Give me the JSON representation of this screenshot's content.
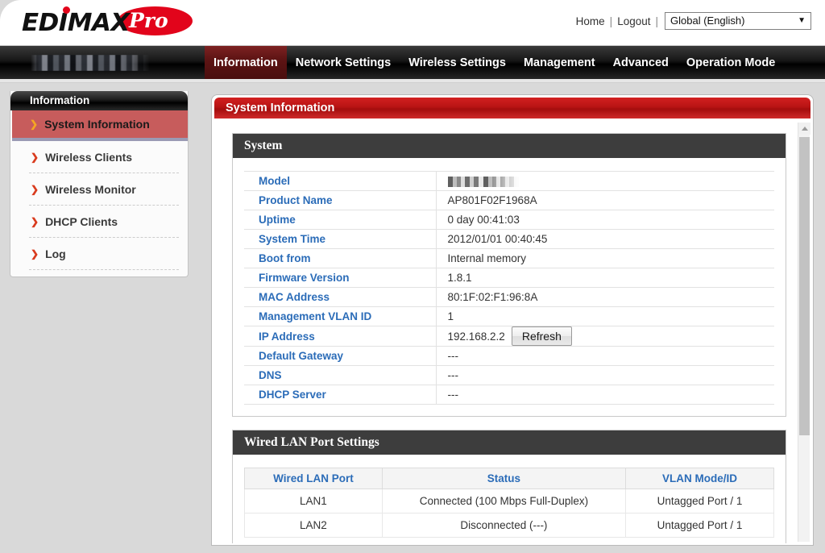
{
  "header": {
    "brand_primary": "EDIMAX",
    "brand_secondary": "Pro",
    "home_label": "Home",
    "logout_label": "Logout",
    "separator": "|",
    "language_value": "Global (English)",
    "dropdown_icon": "chevron-down-icon"
  },
  "nav": {
    "device_name": "",
    "items": [
      {
        "label": "Information",
        "active": true
      },
      {
        "label": "Network Settings",
        "active": false
      },
      {
        "label": "Wireless Settings",
        "active": false
      },
      {
        "label": "Management",
        "active": false
      },
      {
        "label": "Advanced",
        "active": false
      },
      {
        "label": "Operation Mode",
        "active": false
      }
    ]
  },
  "sidebar": {
    "title": "Information",
    "items": [
      {
        "label": "System Information",
        "active": true
      },
      {
        "label": "Wireless Clients",
        "active": false
      },
      {
        "label": "Wireless Monitor",
        "active": false
      },
      {
        "label": "DHCP Clients",
        "active": false
      },
      {
        "label": "Log",
        "active": false
      }
    ]
  },
  "content": {
    "title": "System Information",
    "system_section": {
      "heading": "System",
      "rows": [
        {
          "key": "Model",
          "value": "",
          "redacted": true
        },
        {
          "key": "Product Name",
          "value": "AP801F02F1968A"
        },
        {
          "key": "Uptime",
          "value": " 0 day 00:41:03"
        },
        {
          "key": "System Time",
          "value": "2012/01/01 00:40:45"
        },
        {
          "key": "Boot from",
          "value": "Internal memory"
        },
        {
          "key": "Firmware Version",
          "value": "1.8.1"
        },
        {
          "key": "MAC Address",
          "value": "80:1F:02:F1:96:8A"
        },
        {
          "key": "Management VLAN ID",
          "value": "1"
        },
        {
          "key": "IP Address",
          "value": "192.168.2.2",
          "button": "Refresh"
        },
        {
          "key": "Default Gateway",
          "value": "---"
        },
        {
          "key": "DNS",
          "value": "---"
        },
        {
          "key": "DHCP Server",
          "value": "---"
        }
      ]
    },
    "lan_section": {
      "heading": "Wired LAN Port Settings",
      "columns": [
        "Wired LAN Port",
        "Status",
        "VLAN Mode/ID"
      ],
      "rows": [
        [
          "LAN1",
          "Connected (100 Mbps Full-Duplex)",
          "Untagged Port  /   1"
        ],
        [
          "LAN2",
          "Disconnected (---)",
          "Untagged Port  /   1"
        ]
      ]
    }
  },
  "colors": {
    "brand_red": "#e2041b",
    "nav_active": "#5e1414",
    "title_bar_red": "#b81414",
    "section_head_gray": "#3d3d3d",
    "key_blue": "#2b6cb8",
    "sidebar_active": "#c75c5c"
  }
}
